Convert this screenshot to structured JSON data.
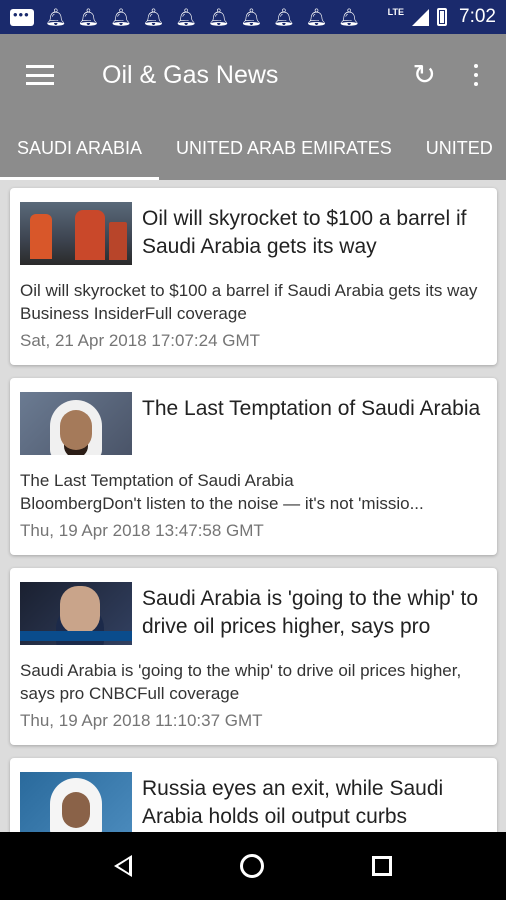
{
  "status_bar": {
    "time": "7:02",
    "network": "LTE",
    "notification_icons": [
      "message-icon",
      "bell-icon",
      "bell-icon",
      "bell-icon",
      "bell-icon",
      "bell-icon",
      "bell-icon",
      "bell-icon",
      "bell-icon",
      "bell-icon",
      "bell-icon"
    ]
  },
  "app_bar": {
    "title": "Oil & Gas News",
    "menu_icon": "hamburger-icon",
    "refresh_icon": "refresh-icon",
    "overflow_icon": "more-vert-icon"
  },
  "tabs": [
    {
      "label": "SAUDI ARABIA",
      "active": true
    },
    {
      "label": "UNITED ARAB EMIRATES",
      "active": false
    },
    {
      "label": "UNITED",
      "active": false
    }
  ],
  "articles": [
    {
      "title": "Oil will skyrocket to $100 a barrel if Saudi Arabia gets its way",
      "summary": "Oil will skyrocket to $100 a barrel if Saudi Arabia gets its way  Business InsiderFull coverage",
      "date": "Sat, 21 Apr 2018 17:07:24 GMT"
    },
    {
      "title": "The Last Temptation of Saudi Arabia",
      "summary_line1": "The Last Temptation of Saudi Arabia",
      "summary_line2": "BloombergDon't listen to the noise — it's not 'missio...",
      "date": "Thu, 19 Apr 2018 13:47:58 GMT"
    },
    {
      "title": "Saudi Arabia is 'going to the whip' to drive oil prices higher, says pro",
      "summary": "Saudi Arabia is 'going to the whip' to drive oil prices higher, says pro  CNBCFull coverage",
      "date": "Thu, 19 Apr 2018 11:10:37 GMT"
    },
    {
      "title": "Russia eyes an exit, while Saudi Arabia holds oil output curbs"
    }
  ]
}
